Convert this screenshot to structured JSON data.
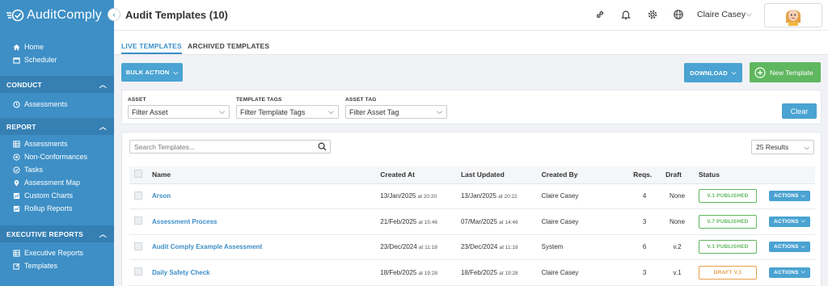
{
  "app": {
    "name": "AuditComply"
  },
  "sidebar": {
    "top_items": [
      {
        "label": "Home",
        "icon": "home-icon"
      },
      {
        "label": "Scheduler",
        "icon": "calendar-icon"
      }
    ],
    "sections": [
      {
        "title": "CONDUCT",
        "items": [
          {
            "label": "Assessments",
            "icon": "clock-icon"
          }
        ]
      },
      {
        "title": "REPORT",
        "items": [
          {
            "label": "Assessments",
            "icon": "table-icon"
          },
          {
            "label": "Non-Conformances",
            "icon": "non-conformance-icon"
          },
          {
            "label": "Tasks",
            "icon": "tasks-icon"
          },
          {
            "label": "Assessment Map",
            "icon": "map-pin-icon"
          },
          {
            "label": "Custom Charts",
            "icon": "chart-icon"
          },
          {
            "label": "Rollup Reports",
            "icon": "rollup-icon"
          }
        ]
      },
      {
        "title": "EXECUTIVE REPORTS",
        "items": [
          {
            "label": "Executive Reports",
            "icon": "table-icon"
          },
          {
            "label": "Templates",
            "icon": "edit-icon"
          }
        ]
      }
    ]
  },
  "header": {
    "title": "Audit Templates (10)",
    "user_name": "Claire Casey"
  },
  "tabs": [
    {
      "label": "LIVE TEMPLATES",
      "active": true
    },
    {
      "label": "ARCHIVED TEMPLATES",
      "active": false
    }
  ],
  "toolbar": {
    "bulk_action": "BULK ACTION",
    "download": "DOWNLOAD",
    "new_template": "New Template"
  },
  "filters": {
    "asset": {
      "label": "ASSET",
      "placeholder": "Filter Asset"
    },
    "template_tags": {
      "label": "TEMPLATE TAGS",
      "placeholder": "Filter Template Tags"
    },
    "asset_tag": {
      "label": "ASSET TAG",
      "placeholder": "Filter Asset Tag"
    },
    "clear": "Clear"
  },
  "table": {
    "search_placeholder": "Search Templates...",
    "results": "25 Results",
    "columns": [
      "Name",
      "Created At",
      "Last Updated",
      "Created By",
      "Reqs.",
      "Draft",
      "Status"
    ],
    "rows": [
      {
        "name": "Arson",
        "created_date": "13/Jan/2025",
        "created_time": "at 20:20",
        "updated_date": "13/Jan/2025",
        "updated_time": "at 20:22",
        "created_by": "Claire Casey",
        "reqs": "4",
        "draft": "None",
        "status": "V.1 PUBLISHED",
        "status_kind": "published",
        "actions": "ACTIONS"
      },
      {
        "name": "Assessment Process",
        "created_date": "21/Feb/2025",
        "created_time": "at 15:46",
        "updated_date": "07/Mar/2025",
        "updated_time": "at 14:46",
        "created_by": "Claire Casey",
        "reqs": "3",
        "draft": "None",
        "status": "V.7 PUBLISHED",
        "status_kind": "published",
        "actions": "ACTIONS"
      },
      {
        "name": "Audit Comply Example Assessment",
        "created_date": "23/Dec/2024",
        "created_time": "at 11:18",
        "updated_date": "23/Dec/2024",
        "updated_time": "at 11:18",
        "created_by": "System",
        "reqs": "6",
        "draft": "v.2",
        "status": "V.1 PUBLISHED",
        "status_kind": "published",
        "actions": "ACTIONS"
      },
      {
        "name": "Daily Safety Check",
        "created_date": "18/Feb/2025",
        "created_time": "at 19:28",
        "updated_date": "18/Feb/2025",
        "updated_time": "at 19:28",
        "created_by": "Claire Casey",
        "reqs": "3",
        "draft": "v.1",
        "status": "DRAFT V.1",
        "status_kind": "draft",
        "actions": "ACTIONS"
      }
    ]
  },
  "colors": {
    "primary": "#3d8fc6",
    "button_blue": "#4aa3d2",
    "green": "#5fb75f",
    "orange": "#e8a04a"
  }
}
